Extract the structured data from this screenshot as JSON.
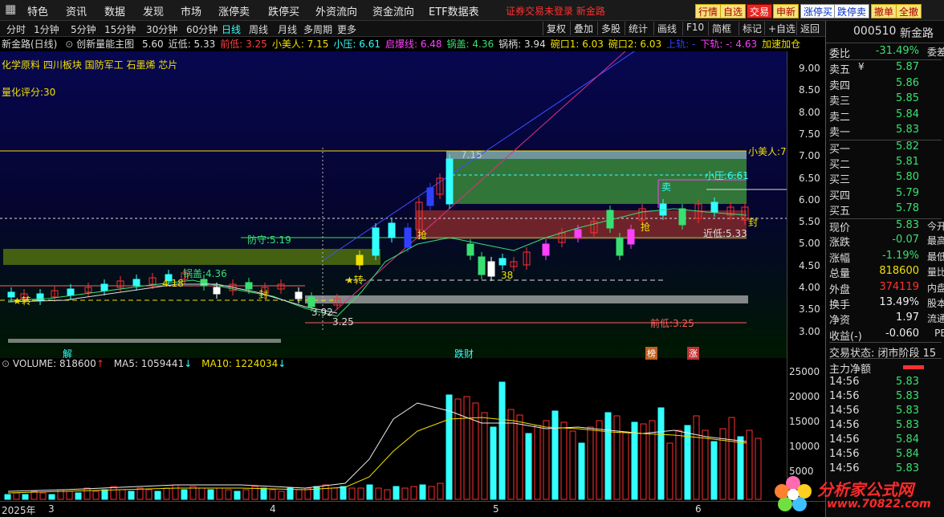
{
  "top_menu": [
    "特色",
    "资讯",
    "数据",
    "发现",
    "市场",
    "涨停卖",
    "跌停买",
    "外资流向",
    "资金流向",
    "ETF数据表"
  ],
  "top_status": "证券交易未登录 新金路",
  "top_buttons": [
    "行情",
    "自选",
    "交易",
    "申新",
    "涨停买",
    "跌停卖",
    "撤单",
    "全撤",
    "",
    ""
  ],
  "periods": [
    "分时",
    "1分钟",
    "5分钟",
    "15分钟",
    "30分钟",
    "60分钟",
    "日线",
    "周线",
    "月线",
    "多周期",
    "更多"
  ],
  "active_period": "日线",
  "toolbar_buttons": [
    "复权",
    "叠加",
    "多股",
    "统计",
    "画线",
    "F10",
    "简框",
    "标记",
    "+自选",
    "返回"
  ],
  "info_line": {
    "stock": "新金路(日线)",
    "indicator": "创新量能主图",
    "items": [
      {
        "label": "5.60",
        "color": "#ddd"
      },
      {
        "label": "近低: 5.33",
        "color": "#ddd"
      },
      {
        "label": "前低: 3.25",
        "color": "#ff4040"
      },
      {
        "label": "小美人: 7.15",
        "color": "#f0e000"
      },
      {
        "label": "小压: 6.61",
        "color": "#3ff"
      },
      {
        "label": "启爆线: 6.48",
        "color": "#ff40ff"
      },
      {
        "label": "锅盖: 4.36",
        "color": "#38e070"
      },
      {
        "label": "锅柄: 3.94",
        "color": "#ddd"
      },
      {
        "label": "碗口1: 6.03",
        "color": "#f0e000"
      },
      {
        "label": "碗口2: 6.03",
        "color": "#f0e000"
      },
      {
        "label": "上轨: -",
        "color": "#3040ff"
      },
      {
        "label": "下轨: -: 4.63",
        "color": "#ff40ff"
      },
      {
        "label": "加速加仓",
        "color": "#f0e000"
      }
    ]
  },
  "chart_labels": {
    "sectors": "化学原料  四川板块  国防军工  石墨烯  芯片",
    "score": "量化评分:30",
    "xiaomeiren": "小美人:7",
    "xiaoya": "小压:6.61",
    "fangshou": "防守:5.19",
    "guogai": "锅盖:4.36",
    "jindi": "近低:5.33",
    "qiandi": "前低:3.25",
    "peak": "7.15",
    "low_mark": "3.25",
    "v418": "4.18",
    "v392": "3.92",
    "v38": "38",
    "qiang": "抢",
    "zhuan": "★转",
    "feng": "封",
    "mai": "卖",
    "jie": "解",
    "diecai": "跌财",
    "bang": "榜",
    "zhang": "涨"
  },
  "y_ticks": [
    "9.00",
    "8.50",
    "8.00",
    "7.50",
    "7.00",
    "6.50",
    "6.00",
    "5.50",
    "5.00",
    "4.50",
    "4.00",
    "3.50",
    "3.00"
  ],
  "volume": {
    "label": "VOLUME: 818600",
    "ma5": "MA5: 1059441",
    "ma10": "MA10: 1224034",
    "y_ticks": [
      "25000",
      "20000",
      "15000",
      "10000",
      "5000"
    ]
  },
  "time_axis": [
    "2025年",
    "3",
    "4",
    "5",
    "6"
  ],
  "right_panel": {
    "code": "000510",
    "name": "新金路",
    "weibi_label": "委比",
    "weibi": "-31.49%",
    "weicha_label": "委差",
    "sell": [
      {
        "label": "卖五",
        "price": "5.87"
      },
      {
        "label": "卖四",
        "price": "5.86"
      },
      {
        "label": "卖三",
        "price": "5.85"
      },
      {
        "label": "卖二",
        "price": "5.84"
      },
      {
        "label": "卖一",
        "price": "5.83"
      }
    ],
    "buy": [
      {
        "label": "买一",
        "price": "5.82"
      },
      {
        "label": "买二",
        "price": "5.81"
      },
      {
        "label": "买三",
        "price": "5.80"
      },
      {
        "label": "买四",
        "price": "5.79"
      },
      {
        "label": "买五",
        "price": "5.78"
      }
    ],
    "stats": [
      {
        "label": "现价",
        "value": "5.83",
        "cls": "green",
        "extra": "今开"
      },
      {
        "label": "涨跌",
        "value": "-0.07",
        "cls": "green",
        "extra": "最高"
      },
      {
        "label": "涨幅",
        "value": "-1.19%",
        "cls": "green",
        "extra": "最低"
      },
      {
        "label": "总量",
        "value": "818600",
        "cls": "yellow",
        "extra": "量比"
      },
      {
        "label": "外盘",
        "value": "374119",
        "cls": "red",
        "extra": "内盘"
      },
      {
        "label": "换手",
        "value": "13.49%",
        "cls": "white",
        "extra": "股本"
      },
      {
        "label": "净资",
        "value": "1.97",
        "cls": "white",
        "extra": "流通"
      },
      {
        "label": "收益(-)",
        "value": "-0.060",
        "cls": "white",
        "extra": "PE"
      }
    ],
    "trade_status": "交易状态: 闭市阶段 15",
    "main_flow_label": "主力净额",
    "ticks": [
      {
        "time": "14:56",
        "price": "5.83"
      },
      {
        "time": "14:56",
        "price": "5.83"
      },
      {
        "time": "14:56",
        "price": "5.83"
      },
      {
        "time": "14:56",
        "price": "5.83"
      },
      {
        "time": "14:56",
        "price": "5.84"
      },
      {
        "time": "14:56",
        "price": "5.84"
      },
      {
        "time": "14:56",
        "price": "5.83"
      }
    ]
  },
  "logo": {
    "text": "分析家公式网",
    "url": "www.70822.com"
  },
  "colors": {
    "up": "#ff3030",
    "down": "#38e070",
    "bg": "#000000",
    "chart_bg": "#07072a"
  }
}
